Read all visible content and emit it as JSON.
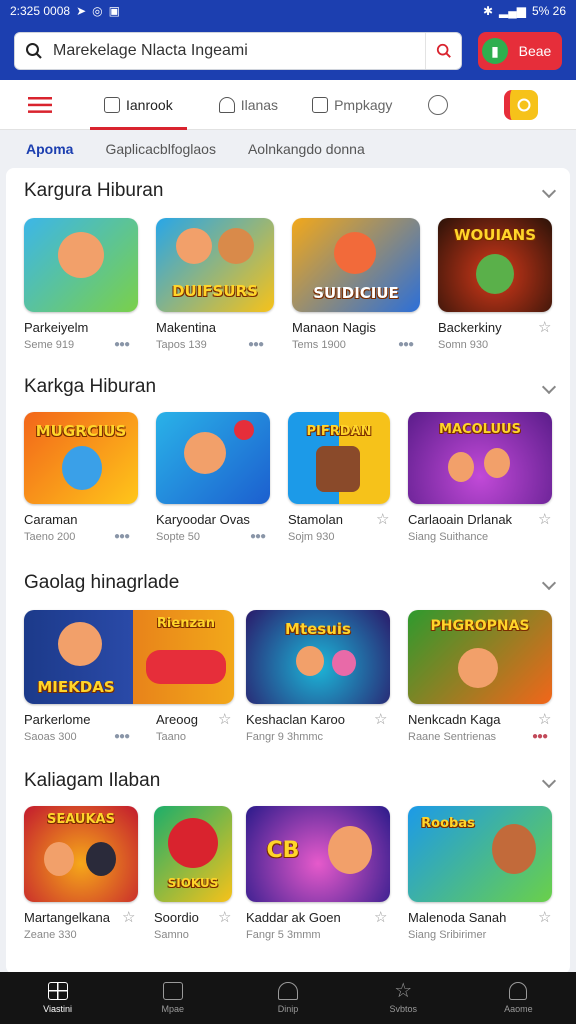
{
  "status_bar": {
    "time": "2:325 0008",
    "battery": "5% 26"
  },
  "search": {
    "value": "Marekelage Nlacta Ingeami",
    "action_label": "Beae"
  },
  "tabs": [
    {
      "label": "Ianrook"
    },
    {
      "label": "Ilanas"
    },
    {
      "label": "Pmpkagy"
    }
  ],
  "subtabs": [
    "Apoma",
    "Gaplicacblfoglaos",
    "Aolnkangdo donna"
  ],
  "sections": [
    {
      "title": "Kargura Hiburan",
      "items": [
        {
          "name": "Parkeiyelm",
          "meta": "Seme 919",
          "banner": "",
          "colors": [
            "#3cb6e8",
            "#7ad04a"
          ]
        },
        {
          "name": "Makentina",
          "meta": "Tapos 139",
          "banner": "DUIFSURS",
          "colors": [
            "#27a6e8",
            "#f6c21a"
          ]
        },
        {
          "name": "Manaon Nagis",
          "meta": "Tems 1900",
          "banner": "SUIDICIUE",
          "colors": [
            "#f2a81a",
            "#2c6fd8"
          ]
        },
        {
          "name": "Backerkiny",
          "meta": "Somn 930",
          "banner": "WOUIANS",
          "colors": [
            "#2a1208",
            "#d5391a"
          ]
        }
      ]
    },
    {
      "title": "Karkga Hiburan",
      "items": [
        {
          "name": "Caraman",
          "meta": "Taeno 200",
          "banner": "MUGRCIUS",
          "colors": [
            "#f2661a",
            "#ffc61a"
          ]
        },
        {
          "name": "Karyoodar Ovas",
          "meta": "Sopte 50",
          "banner": "",
          "colors": [
            "#2ab2e8",
            "#1c5fcf"
          ]
        },
        {
          "name": "Stamolan",
          "meta": "Sojm 930",
          "banner": "PIFRDAN",
          "colors": [
            "#1c9ae8",
            "#f6c21a"
          ]
        },
        {
          "name": "Carlaoain Drlanak",
          "meta": "Siang Suithance",
          "banner": "MACOLUUS",
          "colors": [
            "#5a1c8a",
            "#c24ad8"
          ]
        }
      ]
    },
    {
      "title": "Gaolag hinagrlade",
      "items": [
        {
          "name": "Parkerlome",
          "meta": "Saoas 300",
          "banner": "MIEKDAS",
          "colors": [
            "#1c3a8a",
            "#e8831a"
          ]
        },
        {
          "name": "Areoog",
          "meta": "Taano",
          "banner": "Rienzan",
          "colors": [
            "#1c4a7a",
            "#e62e3a"
          ]
        },
        {
          "name": "Keshaclan Karoo",
          "meta": "Fangr 9 3hmmc",
          "banner": "Mtesuis",
          "colors": [
            "#2a1a6a",
            "#1cb6d8"
          ]
        },
        {
          "name": "Nenkcadn Kaga",
          "meta": "Raane Sentrienas",
          "banner": "PHGROPNAS",
          "colors": [
            "#2e9a2e",
            "#f2661a"
          ]
        }
      ]
    },
    {
      "title": "Kaliagam Ilaban",
      "items": [
        {
          "name": "Martangelkana",
          "meta": "Zeane 330",
          "banner": "SEAUKAS",
          "colors": [
            "#c21a2e",
            "#f6a81a"
          ]
        },
        {
          "name": "Soordio",
          "meta": "Samno",
          "banner": "SIOKUS",
          "colors": [
            "#1cae6a",
            "#f6c21a"
          ]
        },
        {
          "name": "Kaddar ak Goen",
          "meta": "Fangr 5 3mmm",
          "banner": "CB",
          "colors": [
            "#2a1a8a",
            "#e65acb"
          ]
        },
        {
          "name": "Malenoda Sanah",
          "meta": "Siang Sribirimer",
          "banner": "Roobas",
          "colors": [
            "#1c9ae8",
            "#6ad04a"
          ]
        }
      ]
    }
  ],
  "bottom_nav": [
    {
      "label": "Viastini",
      "icon": "grid-icon"
    },
    {
      "label": "Mpae",
      "icon": "tablet-icon"
    },
    {
      "label": "Dinip",
      "icon": "home-icon"
    },
    {
      "label": "Svbtos",
      "icon": "star-icon"
    },
    {
      "label": "Aaome",
      "icon": "person-icon"
    }
  ]
}
